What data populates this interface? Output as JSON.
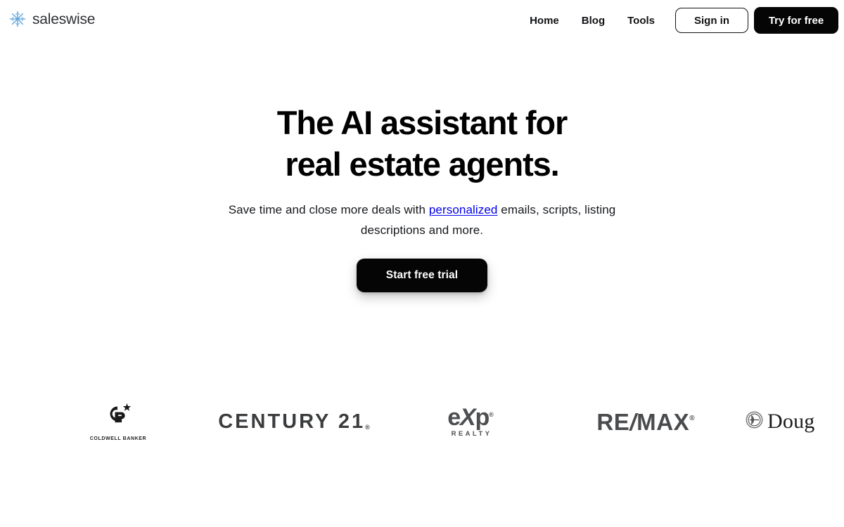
{
  "brand": {
    "name": "saleswise",
    "logo_icon": "snowflake-starburst-icon",
    "logo_color": "#6aa9dd"
  },
  "header": {
    "nav_links": [
      {
        "label": "Home"
      },
      {
        "label": "Blog"
      },
      {
        "label": "Tools"
      }
    ],
    "sign_in_label": "Sign in",
    "try_free_label": "Try for free"
  },
  "hero": {
    "headline_line1": "The AI assistant for",
    "headline_line2": "real estate agents.",
    "subhead_part1": "Save time and close more deals with ",
    "subhead_highlight": "personalized",
    "subhead_part2": " emails, scripts, listing descriptions and more.",
    "cta_label": "Start free trial"
  },
  "logos": {
    "coldwell_banker": {
      "monogram": "CB",
      "name": "COLDWELL BANKER"
    },
    "century21": {
      "name": "CENTURY 21",
      "trademark": "®"
    },
    "exp_realty": {
      "name_e": "e",
      "name_x": "X",
      "name_p": "p",
      "trademark": "®",
      "sub": "REALTY"
    },
    "remax": {
      "part1": "RE",
      "slash": "/",
      "part2": "MAX",
      "trademark": "®"
    },
    "douglas_elliman": {
      "name": "Doug",
      "monogram": "DE"
    }
  },
  "colors": {
    "black": "#050505",
    "text": "#111214",
    "logo_gray": "#4a4b4d",
    "brand_blue": "#6aa9dd"
  }
}
